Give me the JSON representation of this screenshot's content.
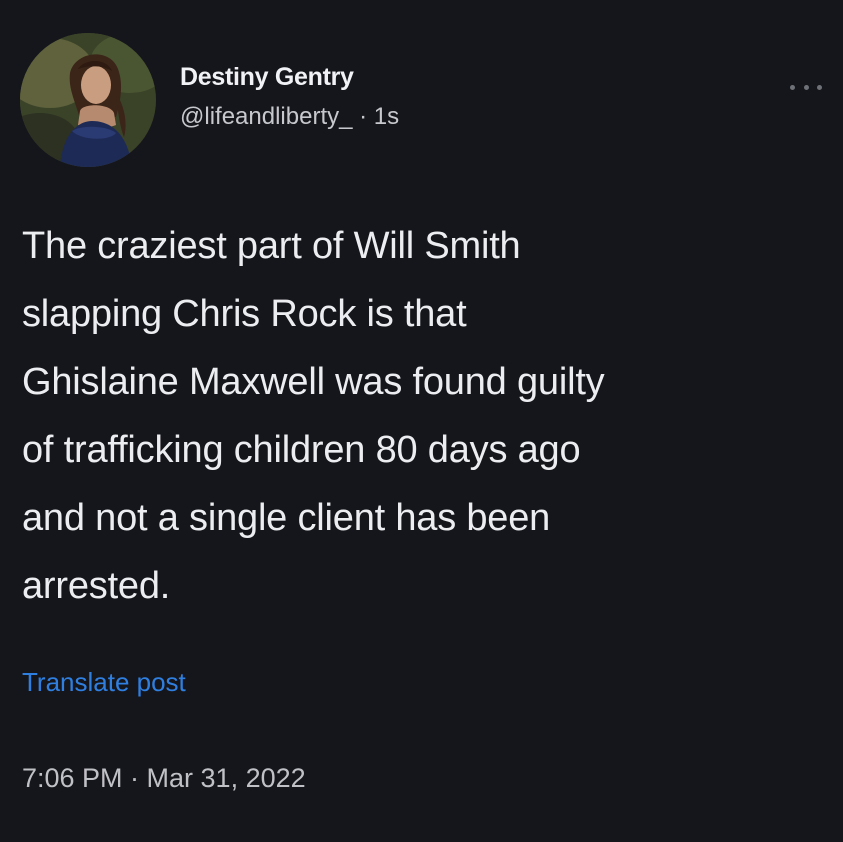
{
  "post": {
    "author": {
      "display_name": "Destiny Gentry",
      "handle": "@lifeandliberty_",
      "age": "· 1s"
    },
    "text": "The craziest part of Will Smith\nslapping Chris Rock is that\nGhislaine Maxwell was found guilty\nof trafficking children 80 days ago\nand not a single client has been\narrested.",
    "translate_label": "Translate post",
    "timestamp": "7:06 PM · Mar 31, 2022",
    "more_icon": "more-horizontal-icon"
  },
  "colors": {
    "background": "#15161b",
    "text": "#ecedf0",
    "secondary_text": "#c0c1c6",
    "link": "#2f7fe0"
  }
}
